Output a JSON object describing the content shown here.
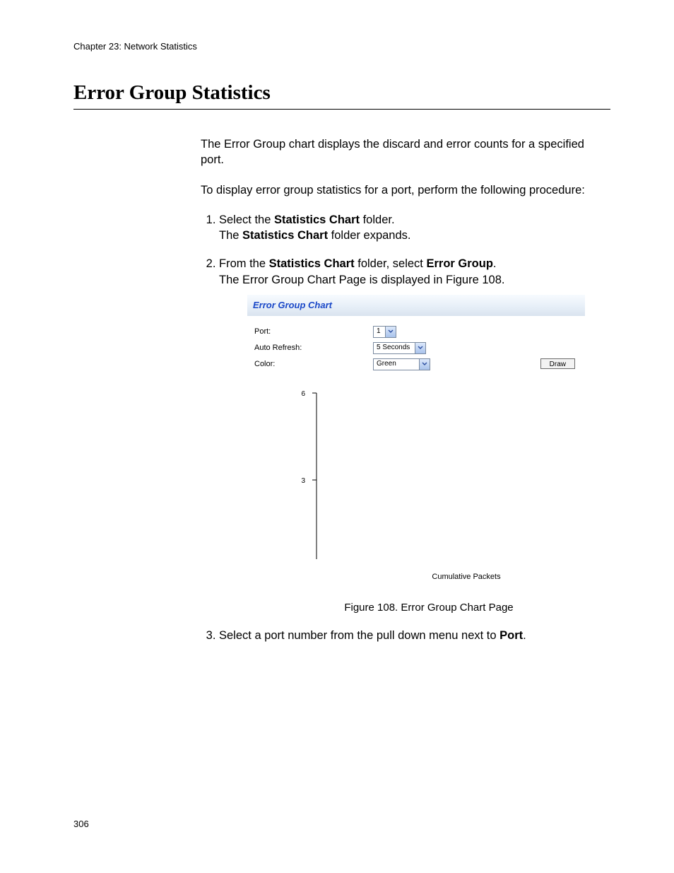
{
  "chapter_line": "Chapter 23: Network Statistics",
  "section_title": "Error Group Statistics",
  "intro_p1": "The Error Group chart displays the discard and error counts for a specified port.",
  "intro_p2": "To display error group statistics for a port, perform the following procedure:",
  "steps": {
    "s1a": "Select the ",
    "s1b": "Statistics Chart",
    "s1c": " folder.",
    "s1d": "The ",
    "s1e": "Statistics Chart",
    "s1f": " folder expands.",
    "s2a": "From the ",
    "s2b": "Statistics Chart",
    "s2c": " folder, select ",
    "s2d": "Error Group",
    "s2e": ".",
    "s2f": "The Error Group Chart Page is displayed in Figure 108.",
    "s3a": "Select a port number from the pull down menu next to ",
    "s3b": "Port",
    "s3c": "."
  },
  "figure": {
    "header_title": "Error Group Chart",
    "labels": {
      "port": "Port:",
      "auto_refresh": "Auto Refresh:",
      "color": "Color:"
    },
    "values": {
      "port": "1",
      "auto_refresh": "5 Seconds",
      "color": "Green"
    },
    "draw_button": "Draw",
    "caption": "Figure 108. Error Group Chart Page"
  },
  "page_number": "306",
  "chart_data": {
    "type": "line",
    "title": "",
    "xlabel": "Cumulative Packets",
    "ylabel": "",
    "y_ticks": [
      3,
      6
    ],
    "ylim": [
      0,
      6
    ],
    "series": []
  }
}
